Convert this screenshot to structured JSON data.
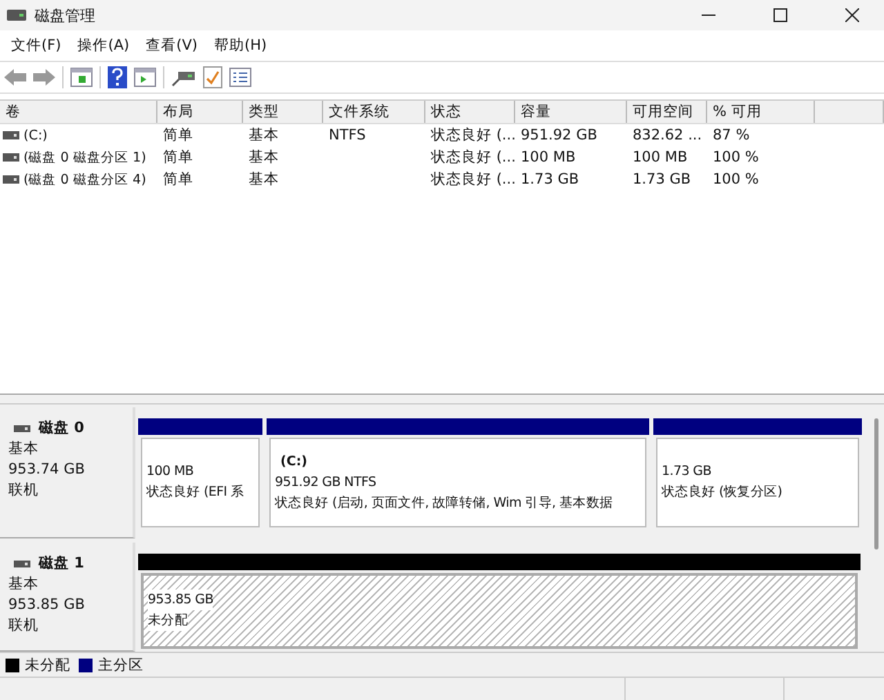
{
  "window": {
    "title": "磁盘管理"
  },
  "menu": [
    "文件(F)",
    "操作(A)",
    "查看(V)",
    "帮助(H)"
  ],
  "table": {
    "columns": [
      "卷",
      "布局",
      "类型",
      "文件系统",
      "状态",
      "容量",
      "可用空间",
      "% 可用"
    ],
    "rows": [
      {
        "cells": [
          "(C:)",
          "简单",
          "基本",
          "NTFS",
          "状态良好 (...",
          "951.92 GB",
          "832.62 ...",
          "87 %"
        ]
      },
      {
        "cells": [
          "(磁盘 0 磁盘分区 1)",
          "简单",
          "基本",
          "",
          "状态良好 (...",
          "100 MB",
          "100 MB",
          "100 %"
        ]
      },
      {
        "cells": [
          "(磁盘 0 磁盘分区 4)",
          "简单",
          "基本",
          "",
          "状态良好 (...",
          "1.73 GB",
          "1.73 GB",
          "100 %"
        ]
      }
    ]
  },
  "disks": [
    {
      "name": "磁盘 0",
      "type": "基本",
      "size": "953.74 GB",
      "status": "联机",
      "partitions": [
        {
          "kind": "primary",
          "size": "100 MB",
          "status": "状态良好 (EFI 系"
        },
        {
          "kind": "primary",
          "label": "(C:)",
          "size": "951.92 GB NTFS",
          "status": "状态良好 (启动, 页面文件, 故障转储, Wim 引导, 基本数据"
        },
        {
          "kind": "primary",
          "size": "1.73 GB",
          "status": "状态良好 (恢复分区)"
        }
      ]
    },
    {
      "name": "磁盘 1",
      "type": "基本",
      "size": "953.85 GB",
      "status": "联机",
      "partitions": [
        {
          "kind": "unallocated",
          "size": "953.85 GB",
          "status": "未分配"
        }
      ]
    }
  ],
  "legend": [
    {
      "label": "未分配",
      "color": "#000000"
    },
    {
      "label": "主分区",
      "color": "#000080"
    }
  ]
}
